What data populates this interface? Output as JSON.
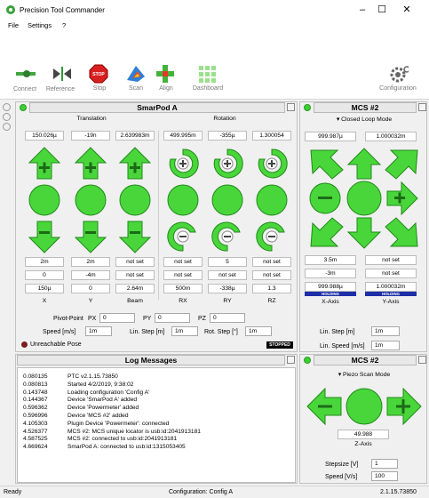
{
  "window": {
    "title": "Precision Tool Commander",
    "minimize": "–",
    "maximize": "☐",
    "close": "✕"
  },
  "menu": [
    "File",
    "Settings",
    "?"
  ],
  "toolbar": {
    "connect": "Connect",
    "reference": "Reference",
    "stop": "Stop",
    "stop_text": "STOP",
    "scan": "Scan",
    "align": "Align",
    "dashboard": "Dashboard",
    "configuration": "Configuration"
  },
  "smarpod": {
    "title": "SmarPod A",
    "translation_label": "Translation",
    "rotation_label": "Rotation",
    "positions": [
      "150.026µ",
      "-19n",
      "2.639983m",
      "499.995m",
      "-355µ",
      "1.300054"
    ],
    "rows": [
      [
        "2m",
        "2m",
        "not set",
        "not set",
        "5",
        "not set"
      ],
      [
        "0",
        "-4m",
        "not set",
        "not set",
        "not set",
        "not set"
      ],
      [
        "150µ",
        "0",
        "2.64m",
        "500m",
        "-338µ",
        "1.3"
      ]
    ],
    "axes": [
      "X",
      "Y",
      "Beam",
      "RX",
      "RY",
      "RZ"
    ],
    "pivot_label": "Pivot-Point",
    "px_label": "PX",
    "px": "0",
    "py_label": "PY",
    "py": "0",
    "pz_label": "PZ",
    "pz": "0",
    "speed_label": "Speed [m/s]",
    "speed": "1m",
    "linstep_label": "Lin. Step [m]",
    "linstep": "1m",
    "rotstep_label": "Rot. Step [°]",
    "rotstep": "1m",
    "unreachable": "Unreachable Pose",
    "stopped": "STOPPED"
  },
  "mcs_top": {
    "title": "MCS #2",
    "mode": "▾ Closed Loop Mode",
    "positions": [
      "999.987µ",
      "1.000032m"
    ],
    "rows": [
      [
        "3.5m",
        "not set"
      ],
      [
        "-3m",
        "not set"
      ]
    ],
    "targets": [
      "999.988µ",
      "1.000032m"
    ],
    "holding": [
      "HOLDING",
      "HOLDING"
    ],
    "axes": [
      "X-Axis",
      "Y-Axis"
    ],
    "linstep_label": "Lin. Step [m]",
    "linstep": "1m",
    "linspeed_label": "Lin. Speed [m/s]",
    "linspeed": "1m"
  },
  "log": {
    "title": "Log Messages",
    "entries": [
      {
        "t": "0.080135",
        "m": "PTC v2.1.15.73850"
      },
      {
        "t": "0.080813",
        "m": "Started 4/2/2019, 9:38:02"
      },
      {
        "t": "0.143748",
        "m": "Loading configuration 'Config A'"
      },
      {
        "t": "0.144367",
        "m": "Device 'SmarPod A' added"
      },
      {
        "t": "0.596362",
        "m": "Device 'Powermeter' added"
      },
      {
        "t": "0.596996",
        "m": "Device 'MCS #2' added"
      },
      {
        "t": "4.105303",
        "m": "Plugin Device 'Powermeter': connected"
      },
      {
        "t": "4.526377",
        "m": "MCS #2: MCS unique locator is usb:id:2041913181"
      },
      {
        "t": "4.587525",
        "m": "MCS #2: connected to usb:id:2041913181"
      },
      {
        "t": "4.669624",
        "m": "SmarPod A: connected to usb:id:1315053405"
      }
    ]
  },
  "mcs_bottom": {
    "title": "MCS #2",
    "mode": "▾ Piezo Scan Mode",
    "value": "49.988",
    "axis": "Z-Axis",
    "stepsize_label": "Stepsize [V]",
    "stepsize": "1",
    "speed_label": "Speed [V/s]",
    "speed": "100"
  },
  "status": {
    "left": "Ready",
    "center": "Configuration: Config A",
    "right": "2.1.15.73850"
  },
  "colors": {
    "button_green": "#49d63b",
    "holding": "#1d2ea8",
    "status_dot": "#3ccf33",
    "stop_red": "#d92020"
  }
}
